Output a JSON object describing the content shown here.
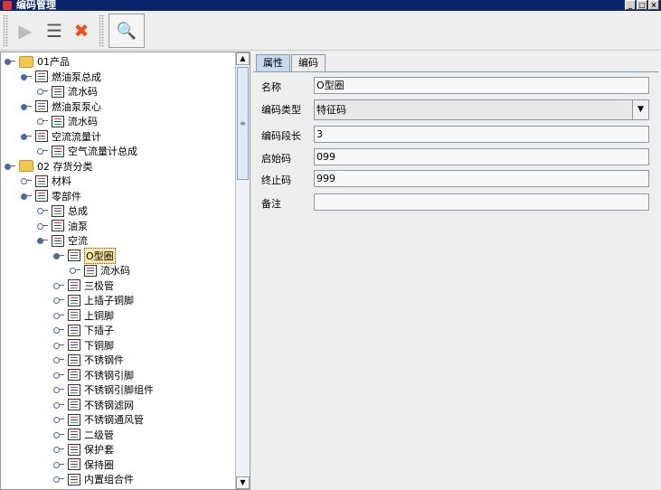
{
  "window": {
    "title": "编码管理",
    "min": "_",
    "max": "□",
    "close": "×"
  },
  "toolbar": {
    "open": "▶",
    "edit": "☰",
    "delete": "✖",
    "search": "🔍"
  },
  "tree": [
    {
      "label": "01产品",
      "depth": 0,
      "type": "folder",
      "open": true
    },
    {
      "label": "燃油泵总成",
      "depth": 1,
      "type": "doc",
      "open": true
    },
    {
      "label": "流水码",
      "depth": 2,
      "type": "doc"
    },
    {
      "label": "燃油泵泵心",
      "depth": 1,
      "type": "doc",
      "open": true
    },
    {
      "label": "流水码",
      "depth": 2,
      "type": "doc"
    },
    {
      "label": "空流流量计",
      "depth": 1,
      "type": "doc",
      "open": true
    },
    {
      "label": "空气流量计总成",
      "depth": 2,
      "type": "doc"
    },
    {
      "label": "02 存货分类",
      "depth": 0,
      "type": "folder",
      "open": true
    },
    {
      "label": "材料",
      "depth": 1,
      "type": "doc"
    },
    {
      "label": "零部件",
      "depth": 1,
      "type": "doc",
      "open": true
    },
    {
      "label": "总成",
      "depth": 2,
      "type": "doc"
    },
    {
      "label": "油泵",
      "depth": 2,
      "type": "doc"
    },
    {
      "label": "空流",
      "depth": 2,
      "type": "doc",
      "open": true
    },
    {
      "label": "O型圈",
      "depth": 3,
      "type": "doc",
      "open": true,
      "selected": true
    },
    {
      "label": "流水码",
      "depth": 4,
      "type": "doc"
    },
    {
      "label": "三极管",
      "depth": 3,
      "type": "doc"
    },
    {
      "label": "上插子铜脚",
      "depth": 3,
      "type": "doc"
    },
    {
      "label": "上铜脚",
      "depth": 3,
      "type": "doc"
    },
    {
      "label": "下插子",
      "depth": 3,
      "type": "doc"
    },
    {
      "label": "下铜脚",
      "depth": 3,
      "type": "doc"
    },
    {
      "label": "不锈钢件",
      "depth": 3,
      "type": "doc"
    },
    {
      "label": "不锈钢引脚",
      "depth": 3,
      "type": "doc"
    },
    {
      "label": "不锈钢引脚组件",
      "depth": 3,
      "type": "doc"
    },
    {
      "label": "不锈钢滤网",
      "depth": 3,
      "type": "doc"
    },
    {
      "label": "不锈钢通风管",
      "depth": 3,
      "type": "doc"
    },
    {
      "label": "二级管",
      "depth": 3,
      "type": "doc"
    },
    {
      "label": "保护套",
      "depth": 3,
      "type": "doc"
    },
    {
      "label": "保持圈",
      "depth": 3,
      "type": "doc"
    },
    {
      "label": "内置组合件",
      "depth": 3,
      "type": "doc"
    }
  ],
  "tabs": [
    "属性",
    "编码"
  ],
  "form": [
    {
      "label": "名称",
      "value": "O型圈"
    },
    {
      "label": "编码类型",
      "value": "特征码",
      "combo": true
    },
    {
      "label": "编码段长",
      "value": "3"
    },
    {
      "label": "启始码",
      "value": "099"
    },
    {
      "label": "终止码",
      "value": "999"
    },
    {
      "label": "备注",
      "value": ""
    }
  ]
}
